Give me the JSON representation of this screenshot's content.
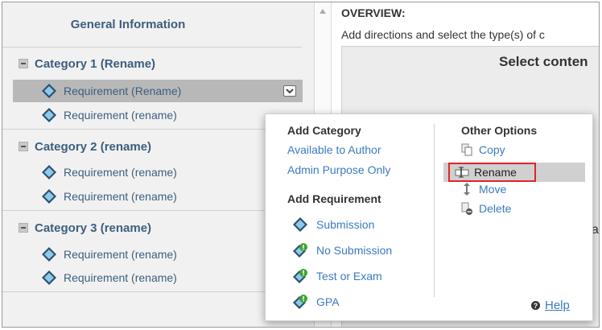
{
  "left_panel": {
    "general_info": "General Information",
    "categories": [
      {
        "label": "Category 1 (Rename)",
        "requirements": [
          {
            "label": "Requirement (Rename)",
            "selected": true
          },
          {
            "label": "Requirement (rename)",
            "selected": false
          }
        ]
      },
      {
        "label": "Category 2 (rename)",
        "requirements": [
          {
            "label": "Requirement (rename)",
            "selected": false
          },
          {
            "label": "Requirement (rename)",
            "selected": false
          }
        ]
      },
      {
        "label": "Category 3 (rename)",
        "requirements": [
          {
            "label": "Requirement (rename)",
            "selected": false
          },
          {
            "label": "Requirement (rename)",
            "selected": false
          }
        ]
      }
    ]
  },
  "right_panel": {
    "overview_title": "OVERVIEW:",
    "directions": "Add directions and select the type(s) of c",
    "select_content": "Select conten",
    "partial_char": "a"
  },
  "popup": {
    "add_category": {
      "heading": "Add Category",
      "links": [
        "Available to Author",
        "Admin Purpose Only"
      ]
    },
    "add_requirement": {
      "heading": "Add Requirement",
      "items": [
        "Submission",
        "No Submission",
        "Test or Exam",
        "GPA"
      ]
    },
    "other_options": {
      "heading": "Other Options",
      "items": [
        "Copy",
        "Rename",
        "Move",
        "Delete"
      ],
      "highlighted": "Rename"
    },
    "help_label": "Help"
  },
  "colors": {
    "link": "#3a7bbf",
    "category_text": "#3d5e7e",
    "highlight_border": "#e0242a",
    "selected_row": "#b8b8b8",
    "badge_green": "#3aa634"
  }
}
